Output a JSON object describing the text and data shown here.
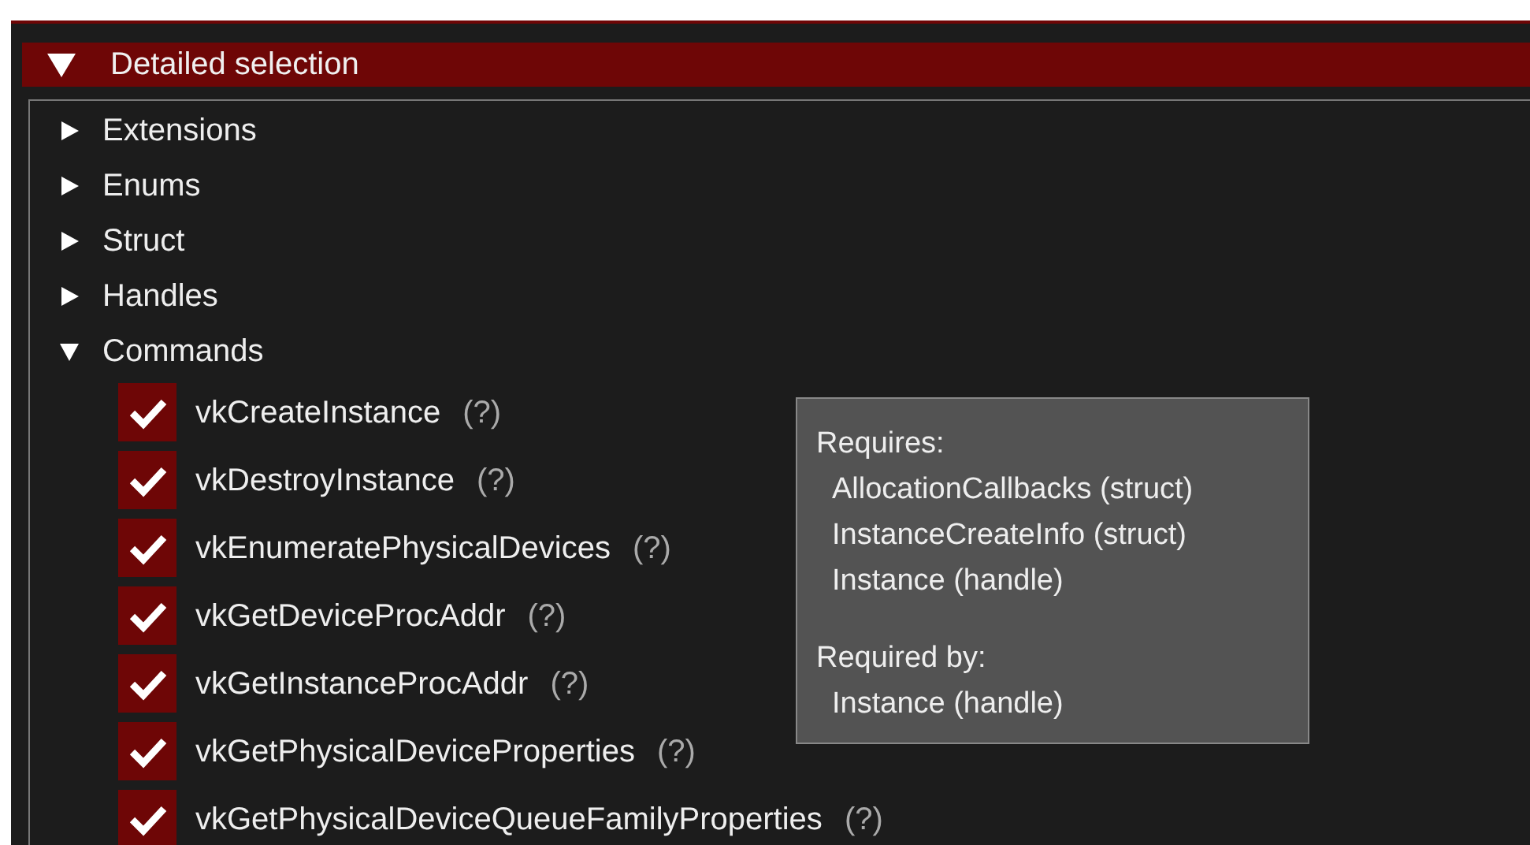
{
  "section": {
    "title": "Detailed selection",
    "expanded": true
  },
  "categories": [
    {
      "label": "Extensions",
      "expanded": false
    },
    {
      "label": "Enums",
      "expanded": false
    },
    {
      "label": "Struct",
      "expanded": false
    },
    {
      "label": "Handles",
      "expanded": false
    },
    {
      "label": "Commands",
      "expanded": true,
      "children": [
        {
          "label": "vkCreateInstance",
          "help": "(?)",
          "checked": true
        },
        {
          "label": "vkDestroyInstance",
          "help": "(?)",
          "checked": true
        },
        {
          "label": "vkEnumeratePhysicalDevices",
          "help": "(?)",
          "checked": true
        },
        {
          "label": "vkGetDeviceProcAddr",
          "help": "(?)",
          "checked": true
        },
        {
          "label": "vkGetInstanceProcAddr",
          "help": "(?)",
          "checked": true
        },
        {
          "label": "vkGetPhysicalDeviceProperties",
          "help": "(?)",
          "checked": true
        },
        {
          "label": "vkGetPhysicalDeviceQueueFamilyProperties",
          "help": "(?)",
          "checked": true
        }
      ]
    }
  ],
  "tooltip": {
    "sections": [
      {
        "heading": "Requires:",
        "items": [
          "AllocationCallbacks (struct)",
          "InstanceCreateInfo (struct)",
          "Instance (handle)"
        ]
      },
      {
        "heading": "Required by:",
        "items": [
          "Instance (handle)"
        ]
      }
    ]
  }
}
